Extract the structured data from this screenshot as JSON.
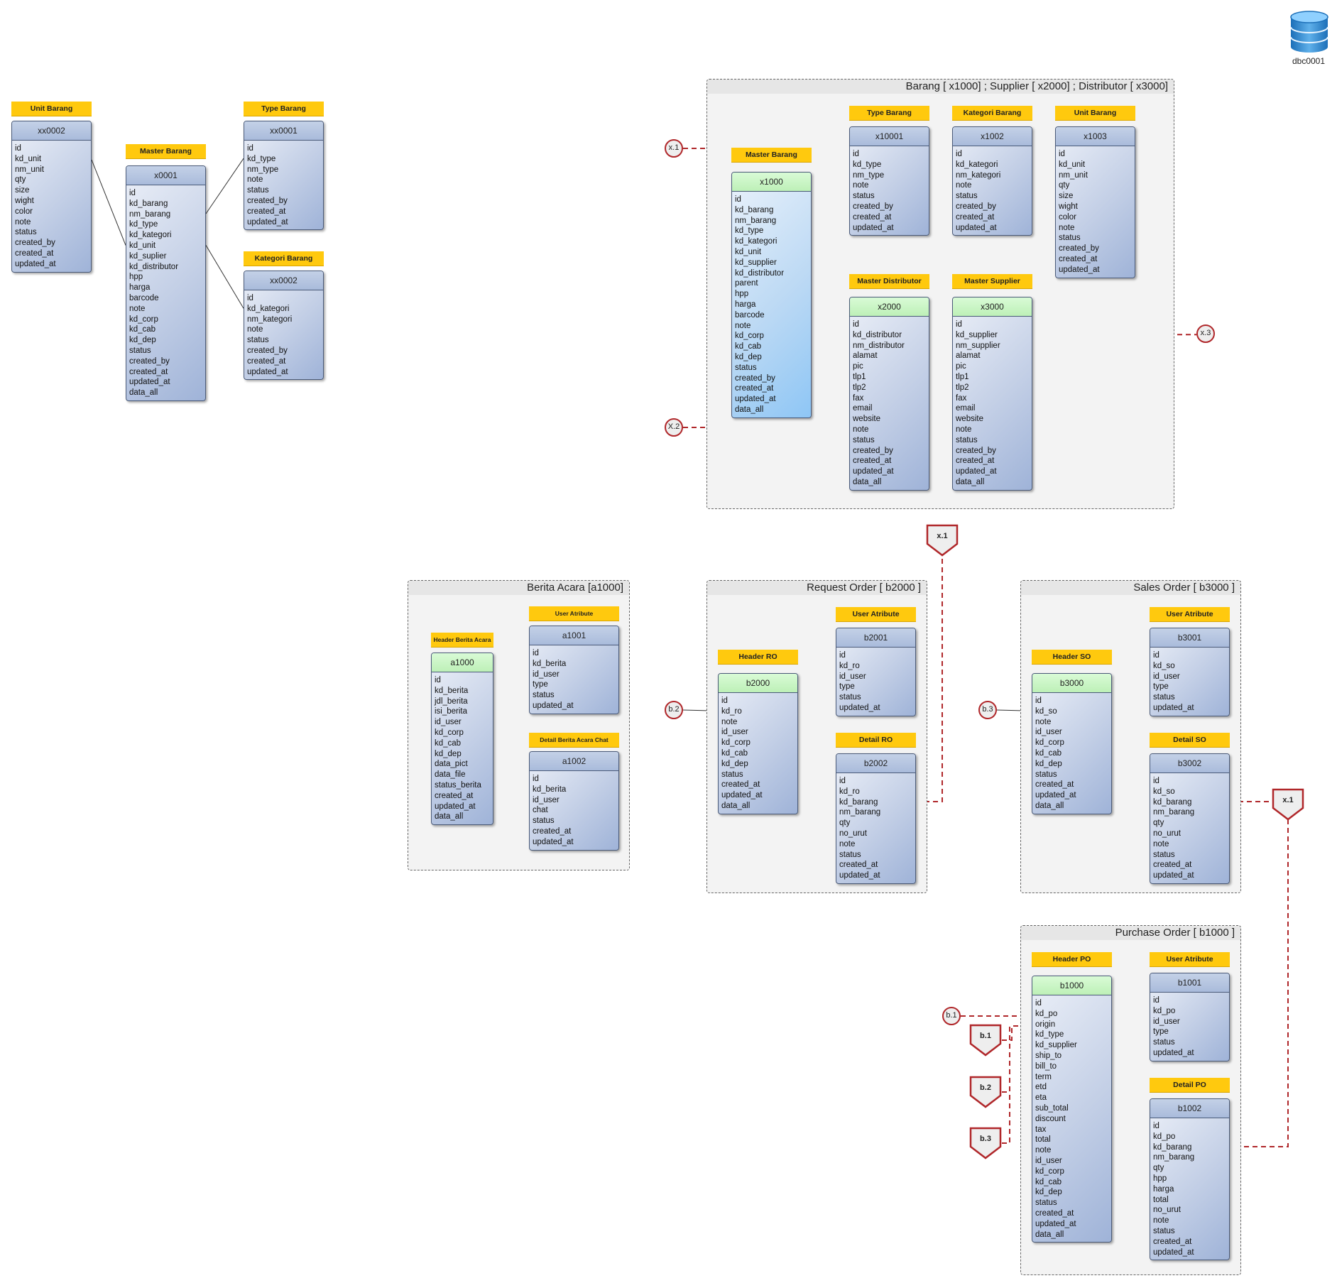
{
  "database": {
    "icon": "database-icon",
    "label": "dbc0001"
  },
  "colors": {
    "tag": "#ffc90e",
    "link": "#b0272a",
    "header_green": "#bdf0b7",
    "table_blue": "#a9bbdb"
  },
  "groups": {
    "barang": "Barang [ x1000] ; Supplier [ x2000] ; Distributor [ x3000]",
    "berita": "Berita Acara [a1000]",
    "ro": "Request Order [ b2000 ]",
    "so": "Sales Order [ b3000 ]",
    "po": "Purchase Order [ b1000 ]"
  },
  "tables": {
    "xx0002u": {
      "tag": "Unit Barang",
      "name": "xx0002",
      "fields": [
        "id",
        "kd_unit",
        "nm_unit",
        "qty",
        "size",
        "wight",
        "color",
        "note",
        "status",
        "created_by",
        "created_at",
        "updated_at"
      ]
    },
    "x0001": {
      "tag": "Master Barang",
      "name": "x0001",
      "fields": [
        "id",
        "kd_barang",
        "nm_barang",
        "kd_type",
        "kd_kategori",
        "kd_unit",
        "kd_suplier",
        "kd_distributor",
        "hpp",
        "harga",
        "barcode",
        "note",
        "kd_corp",
        "kd_cab",
        "kd_dep",
        "status",
        "created_by",
        "created_at",
        "updated_at",
        "data_all"
      ]
    },
    "xx0001": {
      "tag": "Type Barang",
      "name": "xx0001",
      "fields": [
        "id",
        "kd_type",
        "nm_type",
        "note",
        "status",
        "created_by",
        "created_at",
        "updated_at"
      ]
    },
    "xx0002k": {
      "tag": "Kategori Barang",
      "name": "xx0002",
      "fields": [
        "id",
        "kd_kategori",
        "nm_kategori",
        "note",
        "status",
        "created_by",
        "created_at",
        "updated_at"
      ]
    },
    "x1000": {
      "tag": "Master Barang",
      "name": "x1000",
      "fields": [
        "id",
        "kd_barang",
        "nm_barang",
        "kd_type",
        "kd_kategori",
        "kd_unit",
        "kd_supplier",
        "kd_distributor",
        "parent",
        "hpp",
        "harga",
        "barcode",
        "note",
        "kd_corp",
        "kd_cab",
        "kd_dep",
        "status",
        "created_by",
        "created_at",
        "updated_at",
        "data_all"
      ]
    },
    "x10001": {
      "tag": "Type Barang",
      "name": "x10001",
      "fields": [
        "id",
        "kd_type",
        "nm_type",
        "note",
        "status",
        "created_by",
        "created_at",
        "updated_at"
      ]
    },
    "x1002": {
      "tag": "Kategori Barang",
      "name": "x1002",
      "fields": [
        "id",
        "kd_kategori",
        "nm_kategori",
        "note",
        "status",
        "created_by",
        "created_at",
        "updated_at"
      ]
    },
    "x1003": {
      "tag": "Unit Barang",
      "name": "x1003",
      "fields": [
        "id",
        "kd_unit",
        "nm_unit",
        "qty",
        "size",
        "wight",
        "color",
        "note",
        "status",
        "created_by",
        "created_at",
        "updated_at"
      ]
    },
    "x2000": {
      "tag": "Master Distributor",
      "name": "x2000",
      "fields": [
        "id",
        "kd_distributor",
        "nm_distributor",
        "alamat",
        "pic",
        "tlp1",
        "tlp2",
        "fax",
        "email",
        "website",
        "note",
        "status",
        "created_by",
        "created_at",
        "updated_at",
        "data_all"
      ]
    },
    "x3000": {
      "tag": "Master Supplier",
      "name": "x3000",
      "fields": [
        "id",
        "kd_supplier",
        "nm_supplier",
        "alamat",
        "pic",
        "tlp1",
        "tlp2",
        "fax",
        "email",
        "website",
        "note",
        "status",
        "created_by",
        "created_at",
        "updated_at",
        "data_all"
      ]
    },
    "a1000": {
      "tag": "Header Berita Acara",
      "name": "a1000",
      "fields": [
        "id",
        "kd_berita",
        "jdl_berita",
        "isi_berita",
        "id_user",
        "kd_corp",
        "kd_cab",
        "kd_dep",
        "data_pict",
        "data_file",
        "status_berita",
        "created_at",
        "updated_at",
        "data_all"
      ]
    },
    "a1001": {
      "tag": "User Atribute",
      "name": "a1001",
      "fields": [
        "id",
        "kd_berita",
        "id_user",
        "type",
        "status",
        "updated_at"
      ]
    },
    "a1002": {
      "tag": "Detail Berita Acara Chat",
      "name": "a1002",
      "fields": [
        "id",
        "kd_berita",
        "id_user",
        "chat",
        "status",
        "created_at",
        "updated_at"
      ]
    },
    "b2000": {
      "tag": "Header RO",
      "name": "b2000",
      "fields": [
        "id",
        "kd_ro",
        "note",
        "id_user",
        "kd_corp",
        "kd_cab",
        "kd_dep",
        "status",
        "created_at",
        "updated_at",
        "data_all"
      ]
    },
    "b2001": {
      "tag": "User Atribute",
      "name": "b2001",
      "fields": [
        "id",
        "kd_ro",
        "id_user",
        "type",
        "status",
        "updated_at"
      ]
    },
    "b2002": {
      "tag": "Detail RO",
      "name": "b2002",
      "fields": [
        "id",
        "kd_ro",
        "kd_barang",
        "nm_barang",
        "qty",
        "no_urut",
        "note",
        "status",
        "created_at",
        "updated_at"
      ]
    },
    "b3000": {
      "tag": "Header SO",
      "name": "b3000",
      "fields": [
        "id",
        "kd_so",
        "note",
        "id_user",
        "kd_corp",
        "kd_cab",
        "kd_dep",
        "status",
        "created_at",
        "updated_at",
        "data_all"
      ]
    },
    "b3001": {
      "tag": "User Atribute",
      "name": "b3001",
      "fields": [
        "id",
        "kd_so",
        "id_user",
        "type",
        "status",
        "updated_at"
      ]
    },
    "b3002": {
      "tag": "Detail SO",
      "name": "b3002",
      "fields": [
        "id",
        "kd_so",
        "kd_barang",
        "nm_barang",
        "qty",
        "no_urut",
        "note",
        "status",
        "created_at",
        "updated_at"
      ]
    },
    "b1000": {
      "tag": "Header PO",
      "name": "b1000",
      "fields": [
        "id",
        "kd_po",
        "origin",
        "kd_type",
        "kd_supplier",
        "ship_to",
        "bill_to",
        "term",
        "etd",
        "eta",
        "sub_total",
        "discount",
        "tax",
        "total",
        "note",
        "id_user",
        "kd_corp",
        "kd_cab",
        "kd_dep",
        "status",
        "created_at",
        "updated_at",
        "data_all"
      ]
    },
    "b1001": {
      "tag": "User Atribute",
      "name": "b1001",
      "fields": [
        "id",
        "kd_po",
        "id_user",
        "type",
        "status",
        "updated_at"
      ]
    },
    "b1002": {
      "tag": "Detail PO",
      "name": "b1002",
      "fields": [
        "id",
        "kd_po",
        "kd_barang",
        "nm_barang",
        "qty",
        "hpp",
        "harga",
        "total",
        "no_urut",
        "note",
        "status",
        "created_at",
        "updated_at"
      ]
    }
  },
  "connectors": {
    "cx1": "x.1",
    "cx2": "X.2",
    "cx3": "x.3",
    "cb2": "b.2",
    "cb3": "b.3",
    "cb1": "b.1",
    "px1a": "x.1",
    "px1b": "x.1",
    "pb1": "b.1",
    "pb2": "b.2",
    "pb3": "b.3"
  }
}
